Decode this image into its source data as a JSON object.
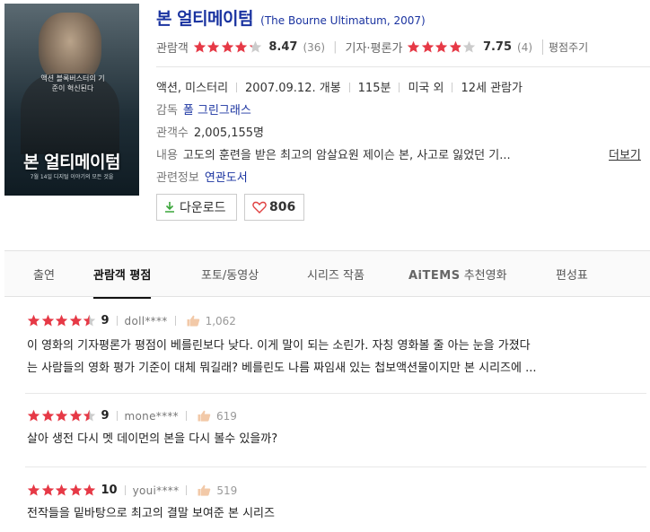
{
  "poster": {
    "tagline": "액션 블록버스터의 기준이 혁신된다",
    "title": "본 얼티메이텀",
    "date_text": "7월 14일 디지털 이야기의 모든 것을"
  },
  "movie": {
    "title_ko": "본 얼티메이텀",
    "title_en": "(The Bourne Ultimatum, 2007)"
  },
  "ratings": {
    "audience_label": "관람객",
    "audience_score": "8.47",
    "audience_count": "(36)",
    "critic_label": "기자·평론가",
    "critic_score": "7.75",
    "critic_count": "(4)",
    "rate_button": "평점주기"
  },
  "info": {
    "genre": "액션, 미스터리",
    "release": "2007.09.12. 개봉",
    "runtime": "115분",
    "country": "미국 외",
    "age": "12세 관람가",
    "director_label": "감독",
    "director": "폴 그린그래스",
    "audience_label": "관객수",
    "audience": "2,005,155명",
    "summary_label": "내용",
    "summary": "고도의 훈련을 받은 최고의 암살요원 제이슨 본, 사고로 잃었던 기...",
    "more": "더보기",
    "related_label": "관련정보",
    "related": "연관도서"
  },
  "buttons": {
    "download": "다운로드",
    "likes": "806"
  },
  "tabs": [
    "출연",
    "관람객 평점",
    "포토/동영상",
    "시리즈 작품",
    "추천영화",
    "편성표"
  ],
  "tab_aitems": "AiTEMS",
  "reviews": [
    {
      "score": "9",
      "user": "doll****",
      "likes": "1,062",
      "line1": "이 영화의 기자평론가 평점이 베를린보다 낮다. 이게 말이 되는 소린가. 자칭 영화볼 줄 아는 눈을 가졌다",
      "line2": "는 사람들의 영화 평가 기준이 대체 뭐길래? 베를린도 나름 짜임새 있는 첩보액션물이지만 본 시리즈에 ...",
      "stars": 4.5
    },
    {
      "score": "9",
      "user": "mone****",
      "likes": "619",
      "line1": "살아 생전 다시 멧 데이먼의 본을 다시 볼수 있을까?",
      "stars": 4.5
    },
    {
      "score": "10",
      "user": "youi****",
      "likes": "519",
      "line1": "전작들을 밑바탕으로 최고의 결말 보여준 본 시리즈",
      "stars": 5
    }
  ],
  "colors": {
    "title": "#1a33a0",
    "star_red": "#e63946",
    "star_gray": "#cccccc",
    "like_heart": "#e04040",
    "download_arrow": "#3aa53a"
  }
}
